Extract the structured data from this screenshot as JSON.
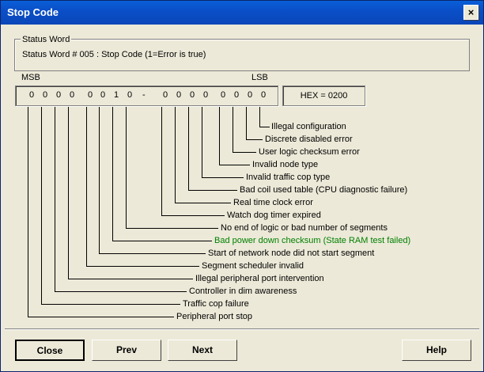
{
  "window": {
    "title": "Stop Code",
    "close_glyph": "×"
  },
  "status_word": {
    "legend": "Status Word",
    "text": "Status Word # 005 : Stop Code (1=Error is true)"
  },
  "bits": {
    "msb_label": "MSB",
    "lsb_label": "LSB",
    "separator": "-",
    "high": [
      "0",
      "0",
      "0",
      "0",
      "0",
      "0",
      "1",
      "0"
    ],
    "low": [
      "0",
      "0",
      "0",
      "0",
      "0",
      "0",
      "0",
      "0"
    ],
    "hex": "HEX = 0200"
  },
  "descriptions": [
    "Illegal configuration",
    "Discrete disabled error",
    "User logic checksum error",
    "Invalid node type",
    "Invalid traffic cop type",
    "Bad coil used table (CPU diagnostic failure)",
    "Real time clock error",
    "Watch dog timer expired",
    "No end of logic or bad number of segments",
    "Bad power down checksum (State RAM test failed)",
    "Start of network node did not start segment",
    "Segment scheduler invalid",
    "Illegal peripheral port intervention",
    "Controller in dim awareness",
    "Traffic cop failure",
    "Peripheral port stop"
  ],
  "highlight_color": "#008000",
  "buttons": {
    "close": "Close",
    "prev": "Prev",
    "next": "Next",
    "help": "Help"
  }
}
